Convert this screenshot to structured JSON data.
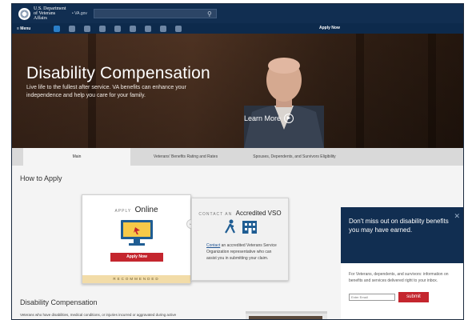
{
  "header": {
    "org_name": "U.S. Department of Veterans Affairs",
    "site": "• VA.gov",
    "search_placeholder": "",
    "search_icon": "search-icon"
  },
  "nav": {
    "menu_label": "≡ Menu",
    "icons": [
      "disability-icon",
      "education-icon",
      "careers-icon",
      "pension-icon",
      "housing-icon",
      "healthcare-icon",
      "burials-icon",
      "life-insurance-icon",
      "family-icon"
    ],
    "apply_now": "Apply Now"
  },
  "hero": {
    "title": "Disability Compensation",
    "subtitle": "Live life to the fullest after service. VA benefits can enhance your independence and help you care for your family.",
    "cta": "Learn More",
    "cta_icon": "chevron-right-icon"
  },
  "tabs": [
    {
      "label": "Main"
    },
    {
      "label": "Veterans' Benefits Rating and Rates"
    },
    {
      "label": "Spouses, Dependents, and Survivors Eligibility"
    }
  ],
  "how_to_apply": {
    "heading": "How to Apply",
    "online": {
      "kicker": "APPLY",
      "title": "Online",
      "button": "Apply Now",
      "badge": "RECOMMENDED",
      "icon": "computer-monitor-icon"
    },
    "vso": {
      "kicker": "CONTACT AN",
      "title": "Accredited VSO",
      "link": "Contact",
      "text": " an accredited Veterans Service Organization representative who can assist you in submitting your claim.",
      "icons": [
        "walking-person-icon",
        "building-icon"
      ]
    },
    "arrow_icon": "arrow-left-icon"
  },
  "disability": {
    "heading": "Disability Compensation",
    "text": "Veterans who have disabilities, medical conditions, or injuries incurred or aggravated during active"
  },
  "signup": {
    "title": "Don't miss out on disability benefits you may have earned.",
    "close_icon": "close-icon",
    "description": "For Veterans, dependents, and survivors: information on benefits and services delivered right to your inbox.",
    "email_placeholder": "Enter Email",
    "submit": "submit"
  }
}
